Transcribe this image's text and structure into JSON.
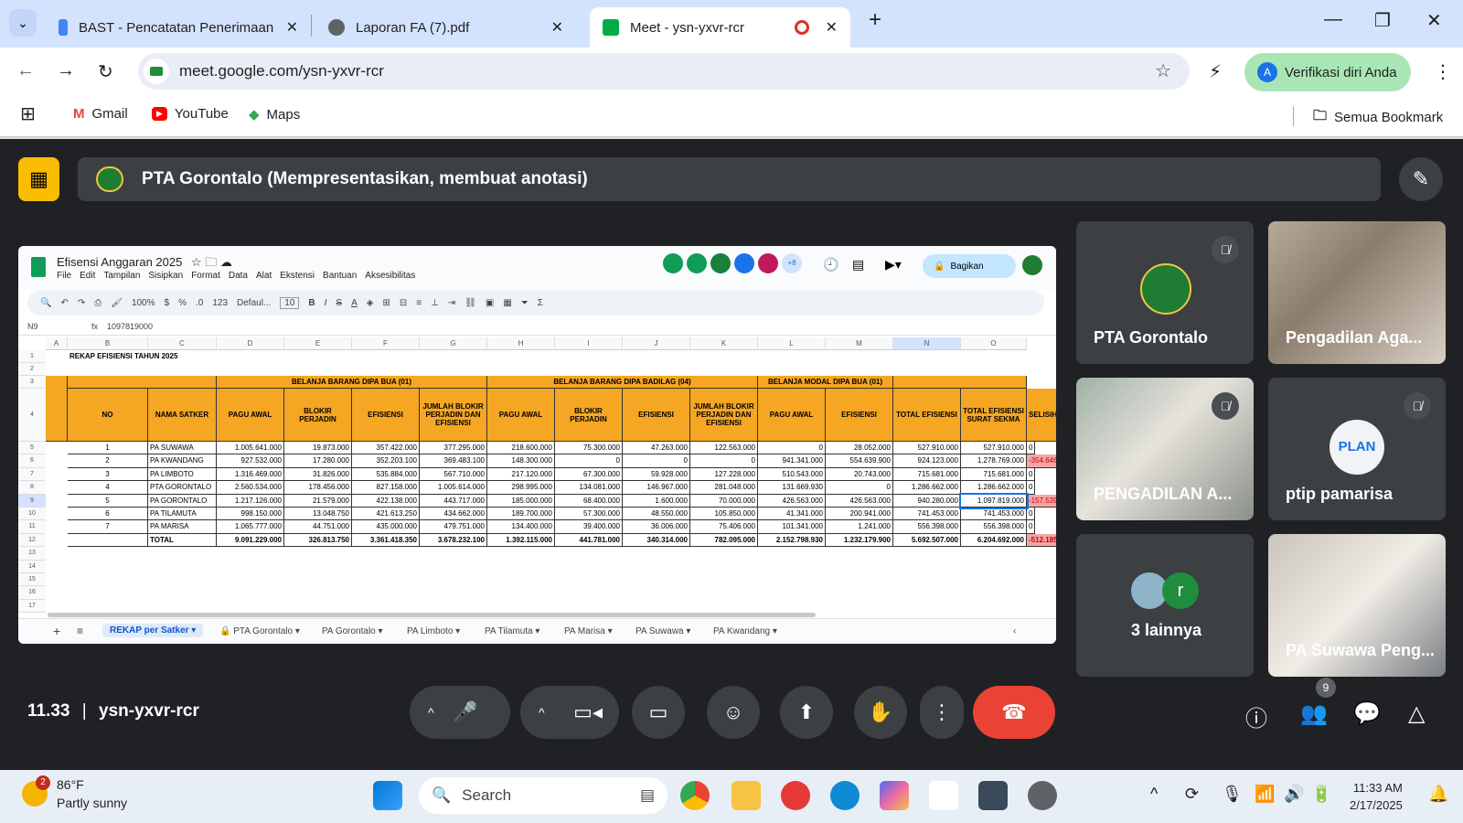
{
  "browser": {
    "tabs": [
      {
        "title": "BAST - Pencatatan Penerimaan",
        "icon": "docs-icon"
      },
      {
        "title": "Laporan FA  (7).pdf",
        "icon": "globe-icon"
      },
      {
        "title": "Meet - ysn-yxvr-rcr",
        "icon": "meet-icon",
        "active": true
      }
    ],
    "url": "meet.google.com/ysn-yxvr-rcr",
    "profile_label": "Verifikasi diri Anda",
    "profile_initial": "A",
    "bookmarks": [
      "Gmail",
      "YouTube",
      "Maps"
    ],
    "all_bookmarks": "Semua Bookmark"
  },
  "meet": {
    "presenting": "PTA Gorontalo (Mempresentasikan, membuat anotasi)",
    "time": "11.33",
    "code": "ysn-yxvr-rcr",
    "participants_count": "9",
    "tiles": [
      {
        "name": "PTA Gorontalo",
        "muted": true,
        "kind": "logo"
      },
      {
        "name": "Pengadilan Aga...",
        "muted": false,
        "kind": "photo"
      },
      {
        "name": "PENGADILAN A...",
        "muted": true,
        "kind": "photo"
      },
      {
        "name": "ptip pamarisa",
        "muted": true,
        "kind": "plan"
      },
      {
        "name": "3 lainnya",
        "muted": false,
        "kind": "others",
        "initial": "r"
      },
      {
        "name": "PA Suwawa Peng...",
        "muted": false,
        "kind": "photo"
      }
    ]
  },
  "sheet": {
    "title": "Efisensi Anggaran 2025",
    "menu": [
      "File",
      "Edit",
      "Tampilan",
      "Sisipkan",
      "Format",
      "Data",
      "Alat",
      "Ekstensi",
      "Bantuan",
      "Aksesibilitas"
    ],
    "share": "Bagikan",
    "avatar_extra": "+8",
    "zoom": "100%",
    "font": "Defaul...",
    "font_size": "10",
    "cell_ref": "N9",
    "formula": "1097819000",
    "col_letters": [
      "A",
      "B",
      "C",
      "D",
      "E",
      "F",
      "G",
      "H",
      "I",
      "J",
      "K",
      "L",
      "M",
      "N",
      "O"
    ],
    "heading": "REKAP EFISIENSI TAHUN 2025",
    "group1": "BELANJA BARANG DIPA BUA (01)",
    "group2": "BELANJA BARANG DIPA BADILAG (04)",
    "group3": "BELANJA MODAL DIPA BUA (01)",
    "headers": [
      "NO",
      "NAMA SATKER",
      "PAGU AWAL",
      "BLOKIR PERJADIN",
      "EFISIENSI",
      "JUMLAH BLOKIR PERJADIN DAN EFISIENSI",
      "PAGU AWAL",
      "BLOKIR PERJADIN",
      "EFISIENSI",
      "JUMLAH BLOKIR PERJADIN DAN EFISIENSI",
      "PAGU AWAL",
      "EFISIENSI",
      "TOTAL EFISIENSI",
      "TOTAL EFISIENSI SURAT SEKMA",
      "SELISIH"
    ],
    "rows": [
      [
        "1",
        "PA SUWAWA",
        "1.005.641.000",
        "19.873.000",
        "357.422.000",
        "377.295.000",
        "218.600.000",
        "75.300.000",
        "47.263.000",
        "122.563.000",
        "0",
        "28.052.000",
        "527.910.000",
        "527.910.000",
        "0"
      ],
      [
        "2",
        "PA KWANDANG",
        "927.532.000",
        "17.280.000",
        "352.203.100",
        "369.483.100",
        "148.300.000",
        "0",
        "0",
        "0",
        "941.341.000",
        "554.639.900",
        "924.123.000",
        "1.278.769.000",
        "-354.646.000"
      ],
      [
        "3",
        "PA LIMBOTO",
        "1.316.469.000",
        "31.826.000",
        "535.884.000",
        "567.710.000",
        "217.120.000",
        "67.300.000",
        "59.928.000",
        "127.228.000",
        "510.543.000",
        "20.743.000",
        "715.681.000",
        "715.681.000",
        "0"
      ],
      [
        "4",
        "PTA GORONTALO",
        "2.560.534.000",
        "178.456.000",
        "827.158.000",
        "1.005.614.000",
        "298.995.000",
        "134.081.000",
        "146.967.000",
        "281.048.000",
        "131.669.930",
        "0",
        "1.286.662.000",
        "1.286.662.000",
        "0"
      ],
      [
        "5",
        "PA GORONTALO",
        "1.217.126.000",
        "21.579.000",
        "422.138.000",
        "443.717.000",
        "185.000.000",
        "68.400.000",
        "1.600.000",
        "70.000.000",
        "426.563.000",
        "426.563.000",
        "940.280.000",
        "1.097.819.000",
        "-157.539.000"
      ],
      [
        "6",
        "PA TILAMUTA",
        "998.150.000",
        "13.048.750",
        "421.613.250",
        "434.662.000",
        "189.700.000",
        "57.300.000",
        "48.550.000",
        "105.850.000",
        "41.341.000",
        "200.941.000",
        "741.453.000",
        "741.453.000",
        "0"
      ],
      [
        "7",
        "PA MARISA",
        "1.065.777.000",
        "44.751.000",
        "435.000.000",
        "479.751.000",
        "134.400.000",
        "39.400.000",
        "36.006.000",
        "75.406.000",
        "101.341.000",
        "1.241.000",
        "556.398.000",
        "556.398.000",
        "0"
      ],
      [
        "",
        "TOTAL",
        "9.091.229.000",
        "326.813.750",
        "3.361.418.350",
        "3.678.232.100",
        "1.392.115.000",
        "441.781.000",
        "340.314.000",
        "782.095.000",
        "2.152.798.930",
        "1.232.179.900",
        "5.692.507.000",
        "6.204.692.000",
        "-512.185.000"
      ]
    ],
    "sheet_tabs": [
      "REKAP per Satker",
      "PTA Gorontalo",
      "PA Gorontalo",
      "PA Limboto",
      "PA Tilamuta",
      "PA Marisa",
      "PA Suwawa",
      "PA Kwandang"
    ]
  },
  "taskbar": {
    "temp": "86°F",
    "weather": "Partly sunny",
    "weather_badge": "2",
    "search": "Search",
    "time": "11:33 AM",
    "date": "2/17/2025"
  }
}
